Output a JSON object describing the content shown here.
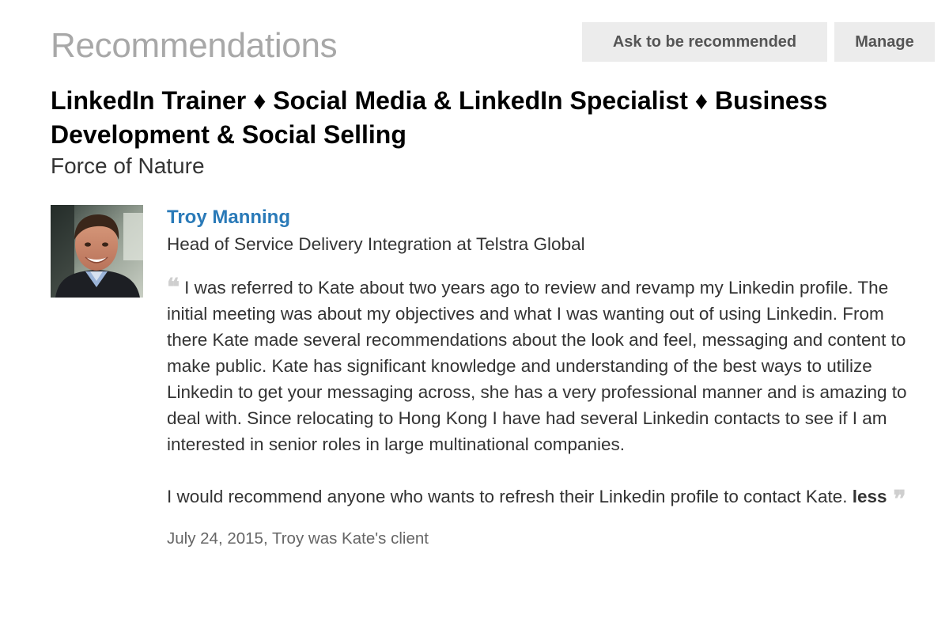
{
  "section": {
    "title": "Recommendations",
    "ask_button_label": "Ask to be recommended",
    "manage_button_label": "Manage"
  },
  "position": {
    "title": "LinkedIn Trainer ♦ Social Media & LinkedIn Specialist ♦ Business Development & Social Selling",
    "company": "Force of Nature"
  },
  "recommendation": {
    "avatar_icon": "person-photo",
    "recommender_name": "Troy Manning",
    "recommender_headline": "Head of Service Delivery Integration at Telstra Global",
    "open_quote": "❝",
    "paragraph_1": "I was referred to Kate about two years ago to review and revamp my Linkedin profile. The initial meeting was about my objectives and what I was wanting out of using Linkedin. From there Kate made several recommendations about the look and feel, messaging and content to make public. Kate has significant knowledge and understanding of the best ways to utilize Linkedin to get your messaging across, she has a very professional manner and is amazing to deal with. Since relocating to Hong Kong I have had several Linkedin contacts to see if I am interested in senior roles in large multinational companies.",
    "paragraph_2": "I would recommend anyone who wants to refresh their Linkedin profile to contact Kate.",
    "less_label": "less",
    "close_quote": "❞",
    "meta": "July 24, 2015, Troy was Kate's client"
  }
}
